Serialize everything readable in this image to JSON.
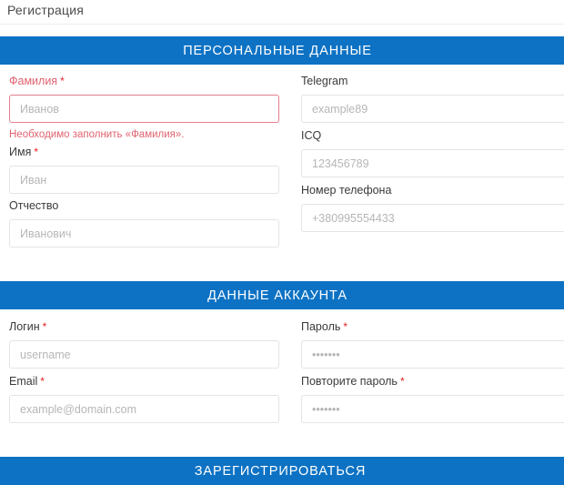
{
  "page": {
    "title": "Регистрация"
  },
  "sections": [
    {
      "id": "personal",
      "banner": "ПЕРСОНАЛЬНЫЕ ДАННЫЕ",
      "left_fields": [
        {
          "label": "Фамилия",
          "required": true,
          "required_mark": "*",
          "placeholder": "Иванов",
          "value": "",
          "state": "error",
          "error": "Необходимо заполнить «Фамилия»."
        },
        {
          "label": "Имя",
          "required": true,
          "required_mark": "*",
          "placeholder": "Иван",
          "value": "",
          "state": "normal",
          "error": ""
        },
        {
          "label": "Отчество",
          "required": false,
          "required_mark": "",
          "placeholder": "Иванович",
          "value": "",
          "state": "normal",
          "error": ""
        }
      ],
      "right_fields": [
        {
          "label": "Telegram",
          "required": false,
          "required_mark": "",
          "placeholder": "example89",
          "value": "",
          "state": "normal",
          "error": ""
        },
        {
          "label": "ICQ",
          "required": false,
          "required_mark": "",
          "placeholder": "123456789",
          "value": "",
          "state": "normal",
          "error": ""
        },
        {
          "label": "Номер телефона",
          "required": false,
          "required_mark": "",
          "placeholder": "+380995554433",
          "value": "",
          "state": "normal",
          "error": ""
        }
      ]
    },
    {
      "id": "account",
      "banner": "ДАННЫЕ АККАУНТА",
      "left_fields": [
        {
          "label": "Логин",
          "required": true,
          "required_mark": "*",
          "placeholder": "username",
          "value": "",
          "state": "normal",
          "error": ""
        },
        {
          "label": "Email",
          "required": true,
          "required_mark": "*",
          "placeholder": "example@domain.com",
          "value": "",
          "state": "normal",
          "error": ""
        }
      ],
      "right_fields": [
        {
          "label": "Пароль",
          "required": true,
          "required_mark": "*",
          "placeholder": "•••••••",
          "value": "",
          "state": "normal",
          "error": ""
        },
        {
          "label": "Повторите пароль",
          "required": true,
          "required_mark": "*",
          "placeholder": "•••••••",
          "value": "",
          "state": "normal",
          "error": ""
        }
      ]
    }
  ],
  "submit": {
    "label": "ЗАРЕГИСТРИРОВАТЬСЯ"
  },
  "colors": {
    "brand_blue": "#0d72c4",
    "error_red": "#e0626f",
    "required_red": "#e8202a",
    "border_gray": "#e4e4e4",
    "placeholder_gray": "#b6b6b6"
  }
}
